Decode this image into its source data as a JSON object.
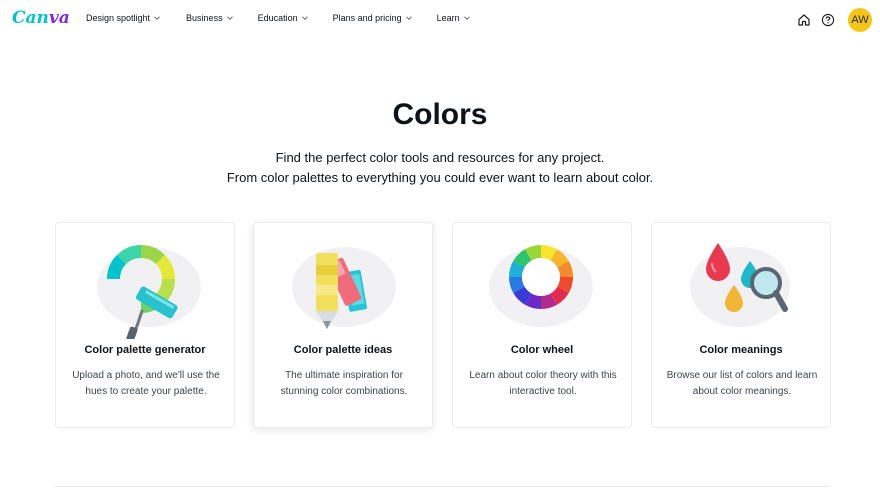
{
  "brand": {
    "name_part1": "Can",
    "name_part2": "va",
    "color_teal": "#00c4cc",
    "color_purple": "#7d2ae8"
  },
  "nav": {
    "items": [
      {
        "label": "Design spotlight"
      },
      {
        "label": "Business"
      },
      {
        "label": "Education"
      },
      {
        "label": "Plans and pricing"
      },
      {
        "label": "Learn"
      }
    ]
  },
  "header_icons": [
    "home-icon",
    "help-icon"
  ],
  "user": {
    "initials": "AW",
    "avatar_color": "#f5c518"
  },
  "hero": {
    "title": "Colors",
    "subtitle_line1": "Find the perfect color tools and resources for any project.",
    "subtitle_line2": "From color palettes to everything you could ever want to learn about color."
  },
  "cards": [
    {
      "title": "Color palette generator",
      "description": "Upload a photo, and we'll use the hues to create your palette.",
      "icon": "paint-roller-icon"
    },
    {
      "title": "Color palette ideas",
      "description": "The ultimate inspiration for stunning color combinations.",
      "icon": "swatch-fan-icon"
    },
    {
      "title": "Color wheel",
      "description": "Learn about color theory with this interactive tool.",
      "icon": "color-wheel-icon"
    },
    {
      "title": "Color meanings",
      "description": "Browse our list of colors and learn about color meanings.",
      "icon": "droplets-magnifier-icon"
    }
  ]
}
